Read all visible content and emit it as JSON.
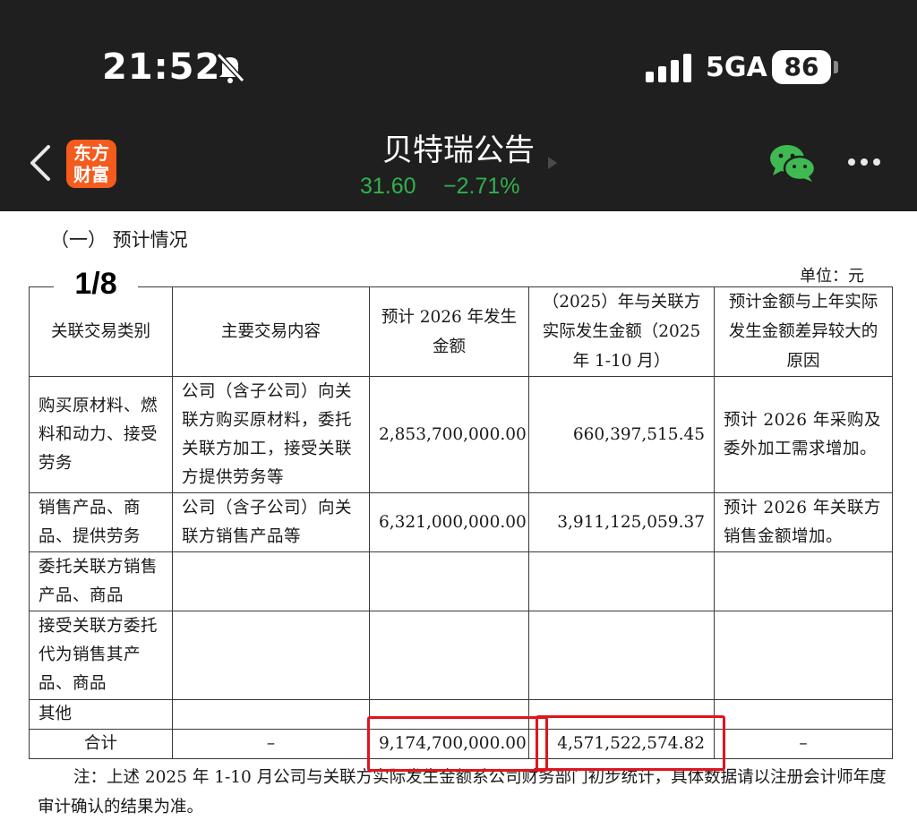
{
  "status_bar": {
    "time": "21:52",
    "network": "5GA",
    "battery": "86",
    "icons": [
      "bell-slash-icon",
      "signal-bars-icon"
    ]
  },
  "app_bar": {
    "logo_line1": "东方",
    "logo_line2": "财富",
    "title": "贝特瑞公告",
    "price": "31.60",
    "change": "−2.71%",
    "price_color": "#2fb24d",
    "logo_color": "#f45b1c",
    "icons": [
      "back-chevron-icon",
      "wechat-icon",
      "more-dots-icon"
    ]
  },
  "document": {
    "section_heading": "（一）  预计情况",
    "unit": "单位：元",
    "page_indicator": "1/8",
    "table": {
      "headers": [
        "关联交易类别",
        "主要交易内容",
        "预计 2026 年发生金额",
        "（2025）年与关联方实际发生金额（2025 年 1-10 月）",
        "预计金额与上年实际发生金额差异较大的原因"
      ],
      "rows": [
        [
          "购买原材料、燃料和动力、接受劳务",
          "公司（含子公司）向关联方购买原材料，委托关联方加工，接受关联方提供劳务等",
          "2,853,700,000.00",
          "660,397,515.45",
          "预计 2026 年采购及委外加工需求增加。"
        ],
        [
          "销售产品、商品、提供劳务",
          "公司（含子公司）向关联方销售产品等",
          "6,321,000,000.00",
          "3,911,125,059.37",
          "预计 2026 年关联方销售金额增加。"
        ],
        [
          "委托关联方销售产品、商品",
          "",
          "",
          "",
          ""
        ],
        [
          "接受关联方委托代为销售其产品、商品",
          "",
          "",
          "",
          ""
        ],
        [
          "其他",
          "",
          "",
          "",
          ""
        ],
        [
          "合计",
          "–",
          "9,174,700,000.00",
          "4,571,522,574.82",
          "–"
        ]
      ]
    },
    "note": "注：上述 2025 年 1-10 月公司与关联方实际发生金额系公司财务部门初步统计，具体数据请以注册会计师年度审计确认的结果为准。",
    "highlight_color": "#e0141d"
  }
}
